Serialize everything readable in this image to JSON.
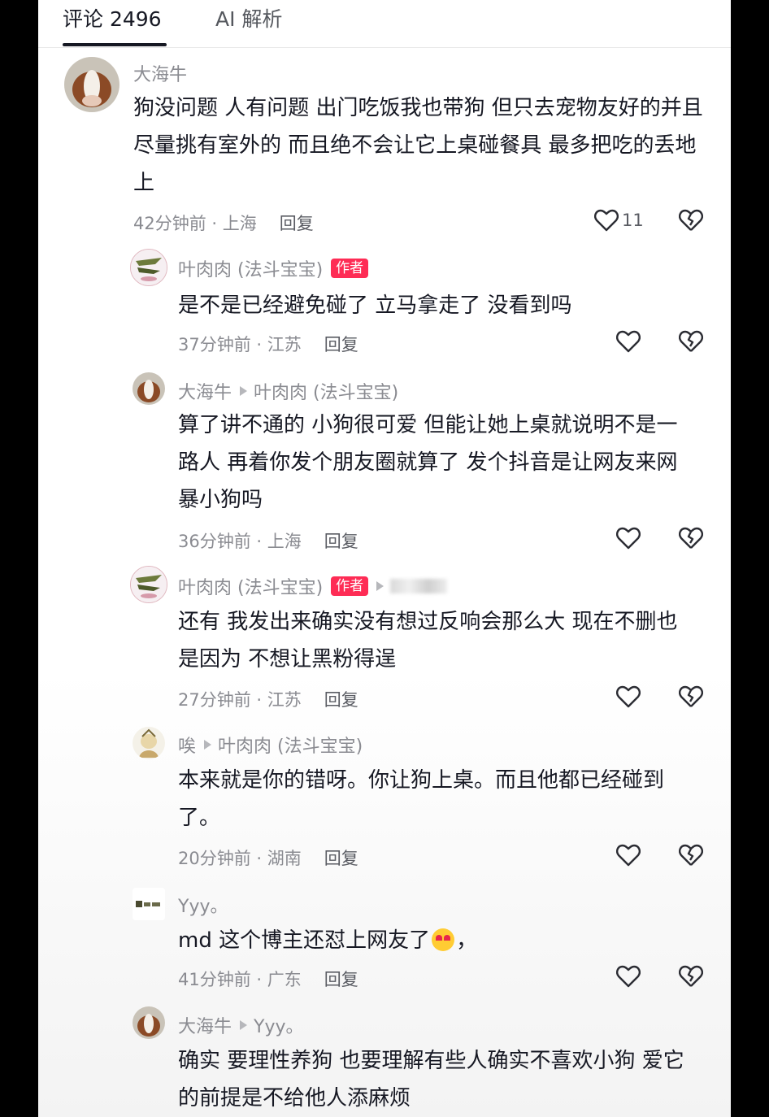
{
  "tabs": [
    {
      "label": "评论 2496"
    },
    {
      "label": "AI 解析"
    }
  ],
  "comments": [
    {
      "user": "大海牛",
      "text": "狗没问题 人有问题 出门吃饭我也带狗 但只去宠物友好的并且尽量挑有室外的 而且绝不会让它上桌碰餐具 最多把吃的丢地上",
      "time": "42分钟前 · 上海",
      "reply": "回复",
      "likes": "11"
    },
    {
      "user": "叶肉肉 (法斗宝宝)",
      "badge": "作者",
      "text": "是不是已经避免碰了 立马拿走了 没看到吗",
      "time": "37分钟前 · 江苏",
      "reply": "回复"
    },
    {
      "user": "大海牛",
      "reply_to": "叶肉肉 (法斗宝宝)",
      "text": "算了讲不通的 小狗很可爱 但能让她上桌就说明不是一路人 再着你发个朋友圈就算了 发个抖音是让网友来网暴小狗吗",
      "time": "36分钟前 · 上海",
      "reply": "回复"
    },
    {
      "user": "叶肉肉 (法斗宝宝)",
      "badge": "作者",
      "text": "还有 我发出来确实没有想过反响会那么大 现在不删也是因为 不想让黑粉得逞",
      "time": "27分钟前 · 江苏",
      "reply": "回复"
    },
    {
      "user": "唉",
      "reply_to": "叶肉肉 (法斗宝宝)",
      "text": "本来就是你的错呀。你让狗上桌。而且他都已经碰到了。",
      "time": "20分钟前 · 湖南",
      "reply": "回复"
    },
    {
      "user": "Yyy。",
      "text_before_emoji": "md 这个博主还怼上网友了",
      "emoji": "smiling-face-with-heart-eyes",
      "text_after_emoji": "，",
      "time": "41分钟前 · 广东",
      "reply": "回复"
    },
    {
      "user": "大海牛",
      "reply_to": "Yyy。",
      "text": "确实 要理性养狗 也要理解有些人确实不喜欢小狗 爱它的前提是不给他人添麻烦"
    }
  ],
  "colors": {
    "text_primary": "#161823",
    "text_secondary": "#8a8b91",
    "author_badge": "#fe2c55"
  }
}
